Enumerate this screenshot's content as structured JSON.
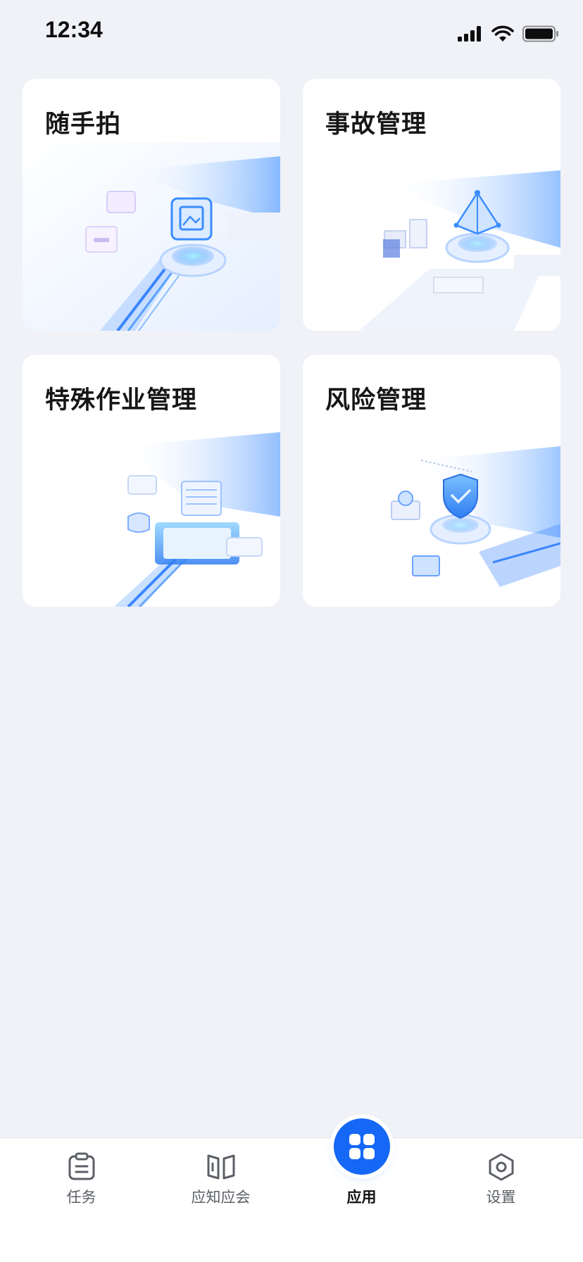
{
  "status_bar": {
    "time": "12:34"
  },
  "cards": [
    {
      "title": "随手拍",
      "icon": "camera-capture-illustration"
    },
    {
      "title": "事故管理",
      "icon": "accident-management-illustration"
    },
    {
      "title": "特殊作业管理",
      "icon": "special-work-illustration"
    },
    {
      "title": "风险管理",
      "icon": "risk-shield-illustration"
    }
  ],
  "tabbar": {
    "tabs": [
      {
        "label": "任务",
        "icon": "clipboard-icon"
      },
      {
        "label": "应知应会",
        "icon": "book-icon"
      },
      {
        "label": "应用",
        "icon": "apps-grid-icon",
        "active": true
      },
      {
        "label": "设置",
        "icon": "settings-hexagon-icon"
      }
    ]
  },
  "colors": {
    "accent": "#1568f5",
    "background": "#f0f2f7"
  }
}
